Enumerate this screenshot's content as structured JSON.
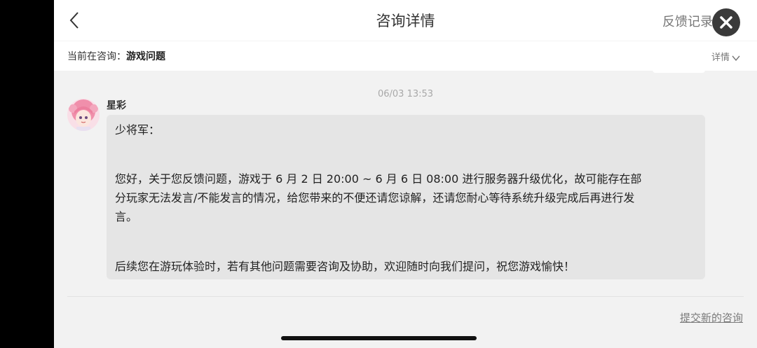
{
  "header": {
    "title": "咨询详情",
    "feedback_link": "反馈记录"
  },
  "consult_bar": {
    "label": "当前在咨询：",
    "topic": "游戏问题",
    "details_label": "详情"
  },
  "conversation": {
    "timestamp": "06/03 13:53",
    "sender": "星彩",
    "message": {
      "greeting": "少将军：",
      "paragraph1_line1": "您好，关于您反馈问题，游戏于 6 月 2 日 20:00 ~ 6 月 6 日 08:00 进行服务器升级优化，故可能存在部",
      "paragraph1_line2": "分玩家无法发言/不能发言的情况，给您带来的不便还请您谅解，还请您耐心等待系统升级完成后再进行发",
      "paragraph1_line3": "言。",
      "paragraph2": "后续您在游玩体验时，若有其他问题需要咨询及协助，欢迎随时向我们提问，祝您游戏愉快！"
    }
  },
  "footer": {
    "submit_link": "提交新的咨询"
  },
  "colors": {
    "bubble": "#e5e5e5",
    "page_bg": "#f2f2f2",
    "close_button": "#3a3a3a"
  }
}
